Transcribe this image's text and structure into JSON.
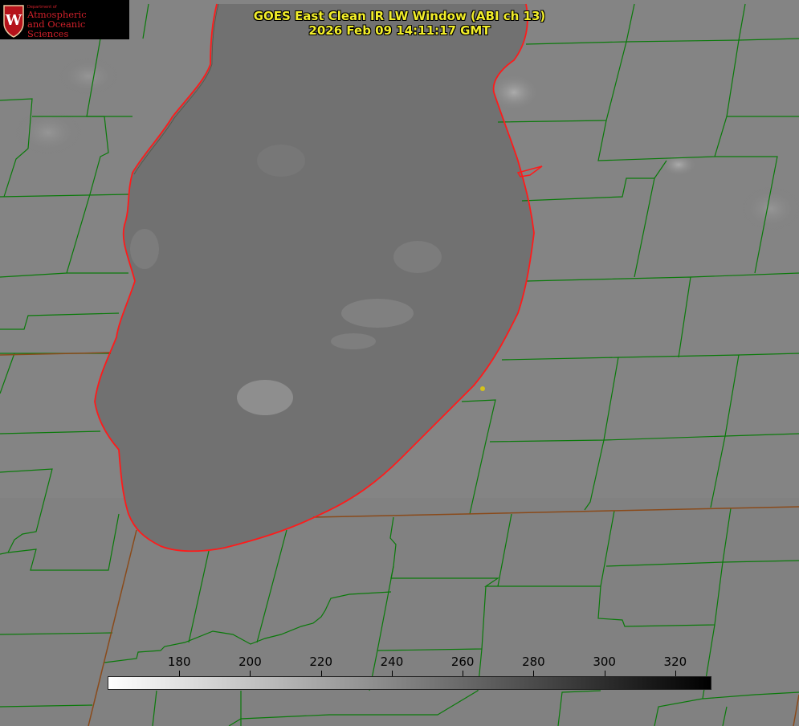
{
  "header": {
    "title_line1": "GOES East Clean IR LW Window (ABI ch 13)",
    "title_line2": "2026 Feb 09 14:11:17 GMT",
    "title_color": "#f2ee2a"
  },
  "logo": {
    "dept": "Department of",
    "line1": "Atmospheric",
    "line2": "and Oceanic Sciences",
    "emblem": "wisconsin-crest-icon",
    "color": "#d0202a"
  },
  "colorbar": {
    "min": 160,
    "max": 330,
    "ticks": [
      180,
      200,
      220,
      240,
      260,
      280,
      300,
      320
    ],
    "tick_labels": [
      "180",
      "200",
      "220",
      "240",
      "260",
      "280",
      "300",
      "320"
    ],
    "gradient": "white-to-black"
  },
  "map_colors": {
    "land": "#858585",
    "lake": "#6f6f6f",
    "county_lines": "#0a7a0a",
    "state_lines": "#8a4a1a",
    "shoreline": "#ff1a1a",
    "marker": "#d4c21a"
  }
}
